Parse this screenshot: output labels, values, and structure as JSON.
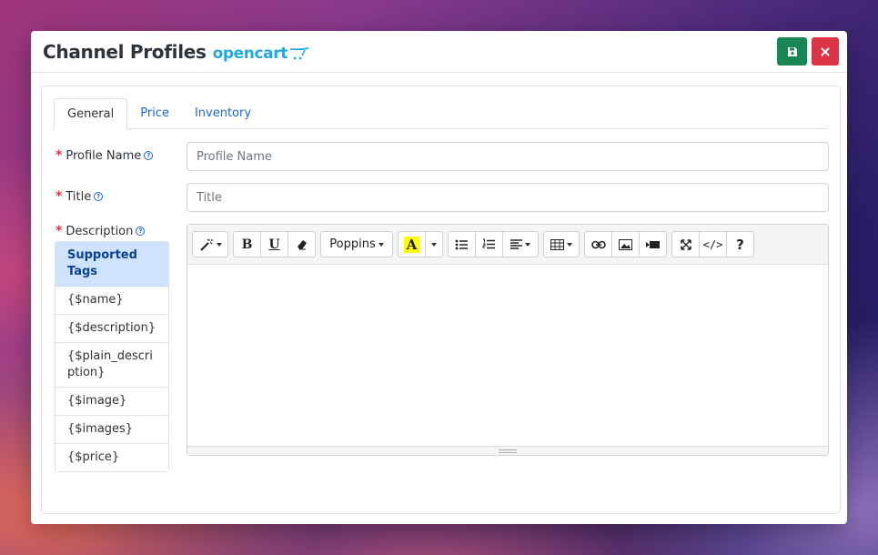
{
  "header": {
    "title": "Channel Profiles",
    "logo_text": "opencart",
    "save_icon": "save-icon",
    "close_icon": "close-icon"
  },
  "tabs": [
    {
      "label": "General",
      "active": true
    },
    {
      "label": "Price",
      "active": false
    },
    {
      "label": "Inventory",
      "active": false
    }
  ],
  "form": {
    "profile_name": {
      "label": "Profile Name",
      "required": "*",
      "help": "?",
      "placeholder": "Profile Name",
      "value": ""
    },
    "title": {
      "label": "Title",
      "required": "*",
      "help": "?",
      "placeholder": "Title",
      "value": ""
    },
    "description": {
      "label": "Description",
      "required": "*",
      "help": "?"
    }
  },
  "supported_tags": {
    "heading": "Supported Tags",
    "items": [
      "{$name}",
      "{$description}",
      "{$plain_description}",
      "{$image}",
      "{$images}",
      "{$price}"
    ]
  },
  "editor": {
    "font_select": "Poppins",
    "bold": "B",
    "underline": "U",
    "highlight": "A",
    "code_view": "</>",
    "help": "?"
  },
  "colors": {
    "save": "#198754",
    "close": "#dc3545",
    "link": "#1a66d6",
    "tag_header_bg": "#cfe2ff",
    "highlight": "#ffff00"
  }
}
